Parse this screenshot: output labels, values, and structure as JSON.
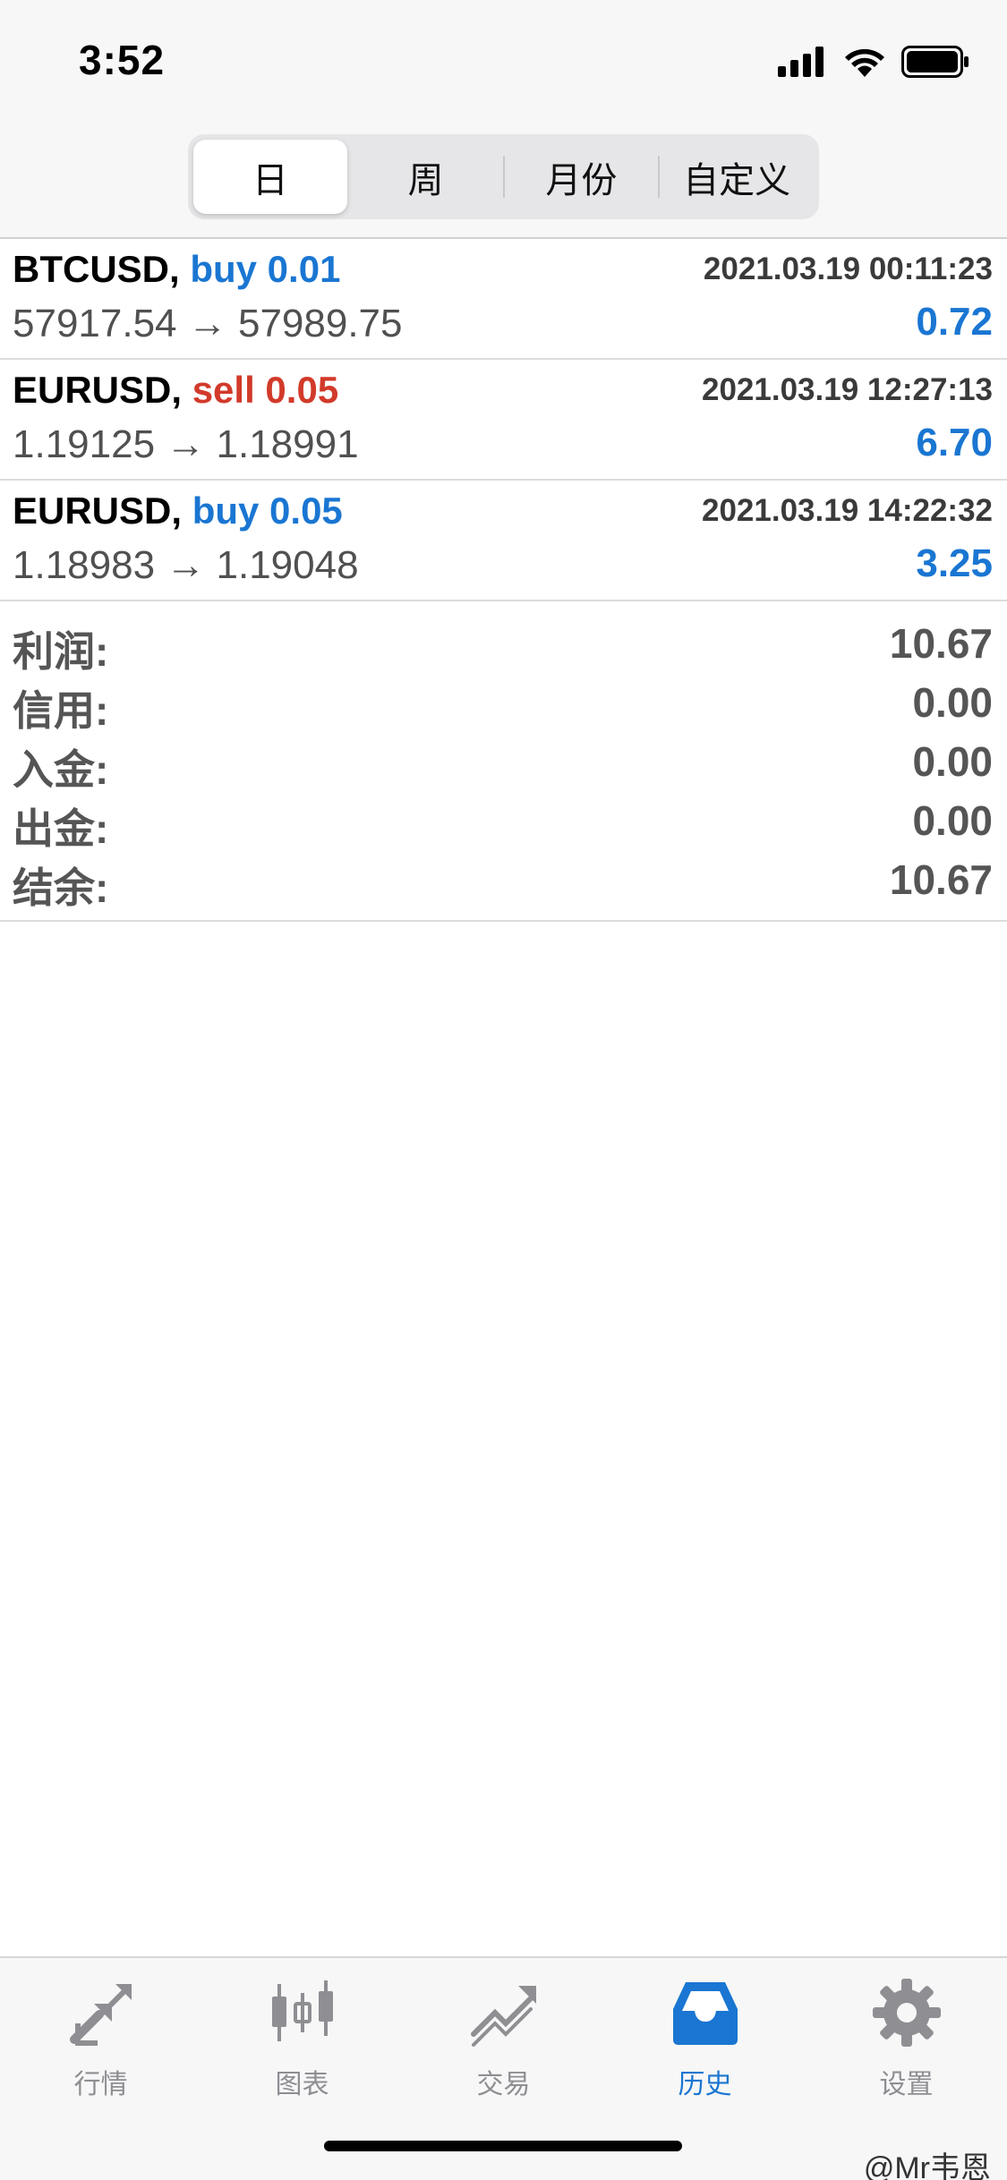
{
  "status_bar": {
    "time": "3:52"
  },
  "periods": {
    "tabs": [
      {
        "label": "日",
        "active": true
      },
      {
        "label": "周",
        "active": false
      },
      {
        "label": "月份",
        "active": false
      },
      {
        "label": "自定义",
        "active": false
      }
    ]
  },
  "trades": [
    {
      "symbol": "BTCUSD,",
      "side": "buy 0.01",
      "type": "buy",
      "time": "2021.03.19 00:11:23",
      "prices": "57917.54 → 57989.75",
      "profit": "0.72"
    },
    {
      "symbol": "EURUSD,",
      "side": "sell 0.05",
      "type": "sell",
      "time": "2021.03.19 12:27:13",
      "prices": "1.19125 → 1.18991",
      "profit": "6.70"
    },
    {
      "symbol": "EURUSD,",
      "side": "buy 0.05",
      "type": "buy",
      "time": "2021.03.19 14:22:32",
      "prices": "1.18983 → 1.19048",
      "profit": "3.25"
    }
  ],
  "summary": [
    {
      "label": "利润:",
      "value": "10.67"
    },
    {
      "label": "信用:",
      "value": "0.00"
    },
    {
      "label": "入金:",
      "value": "0.00"
    },
    {
      "label": "出金:",
      "value": "0.00"
    },
    {
      "label": "结余:",
      "value": "10.67"
    }
  ],
  "tabbar": {
    "items": [
      {
        "label": "行情",
        "icon": "quotes-arrows-icon",
        "active": false
      },
      {
        "label": "图表",
        "icon": "candlestick-chart-icon",
        "active": false
      },
      {
        "label": "交易",
        "icon": "trade-trend-icon",
        "active": false
      },
      {
        "label": "历史",
        "icon": "history-inbox-icon",
        "active": true
      },
      {
        "label": "设置",
        "icon": "gear-icon",
        "active": false
      }
    ]
  },
  "watermark": "@Mr韦恩",
  "colors": {
    "accent": "#1a76d2",
    "sell": "#d23a2a",
    "inactive": "#8e8e93"
  }
}
